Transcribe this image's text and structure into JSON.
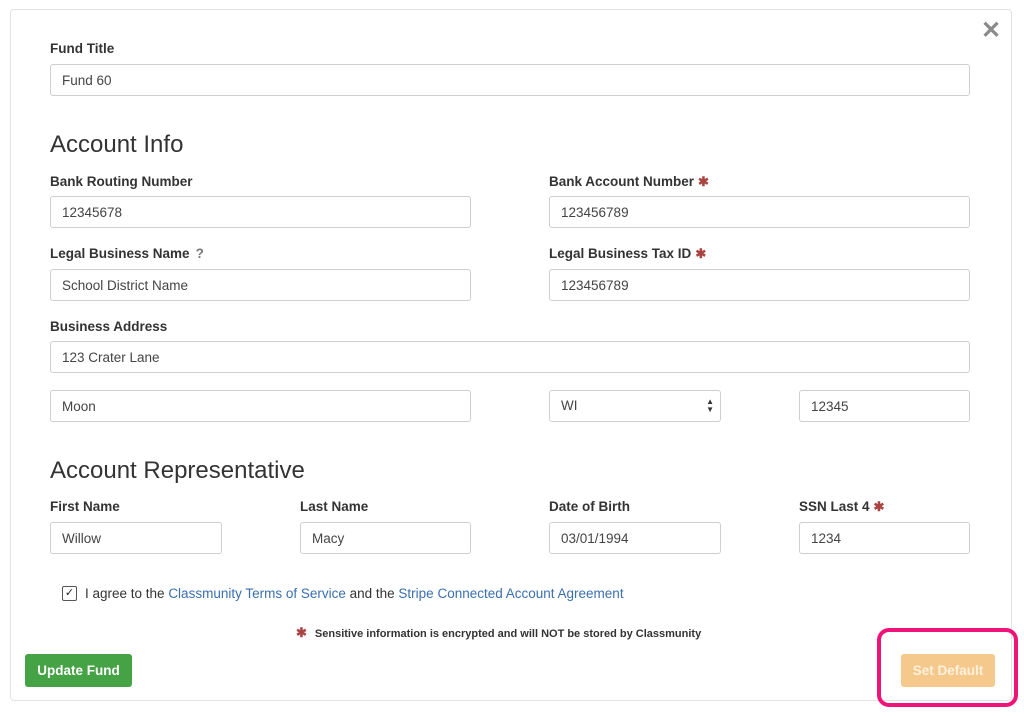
{
  "close_glyph": "✕",
  "fund": {
    "label": "Fund Title",
    "value": "Fund 60"
  },
  "account_info": {
    "heading": "Account Info",
    "routing": {
      "label": "Bank Routing Number",
      "value": "12345678"
    },
    "account": {
      "label": "Bank Account Number",
      "value": "123456789",
      "required_mark": "✱"
    },
    "business_name": {
      "label": "Legal Business Name",
      "help": "?",
      "value": "School District Name"
    },
    "tax_id": {
      "label": "Legal Business Tax ID",
      "value": "123456789",
      "required_mark": "✱"
    },
    "address": {
      "label": "Business Address",
      "street": "123 Crater Lane",
      "city": "Moon",
      "state": "WI",
      "zip": "12345"
    }
  },
  "representative": {
    "heading": "Account Representative",
    "first_name": {
      "label": "First Name",
      "value": "Willow"
    },
    "last_name": {
      "label": "Last Name",
      "value": "Macy"
    },
    "dob": {
      "label": "Date of Birth",
      "value": "03/01/1994"
    },
    "ssn": {
      "label": "SSN Last 4",
      "value": "1234",
      "required_mark": "✱"
    }
  },
  "agreement": {
    "checked_glyph": "✓",
    "prefix": "I agree to the ",
    "terms_link": "Classmunity Terms of Service",
    "middle": " and the ",
    "stripe_link": "Stripe Connected Account Agreement"
  },
  "note": {
    "mark": "✱",
    "text": "Sensitive information is encrypted and will NOT be stored by Classmunity"
  },
  "buttons": {
    "update": "Update Fund",
    "set_default": "Set Default"
  },
  "colors": {
    "update_green": "#45a245",
    "set_default_disabled": "#f5c98c",
    "required_red": "#a94442",
    "link_blue": "#3a6fb0",
    "highlight_pink": "#f0147a"
  }
}
